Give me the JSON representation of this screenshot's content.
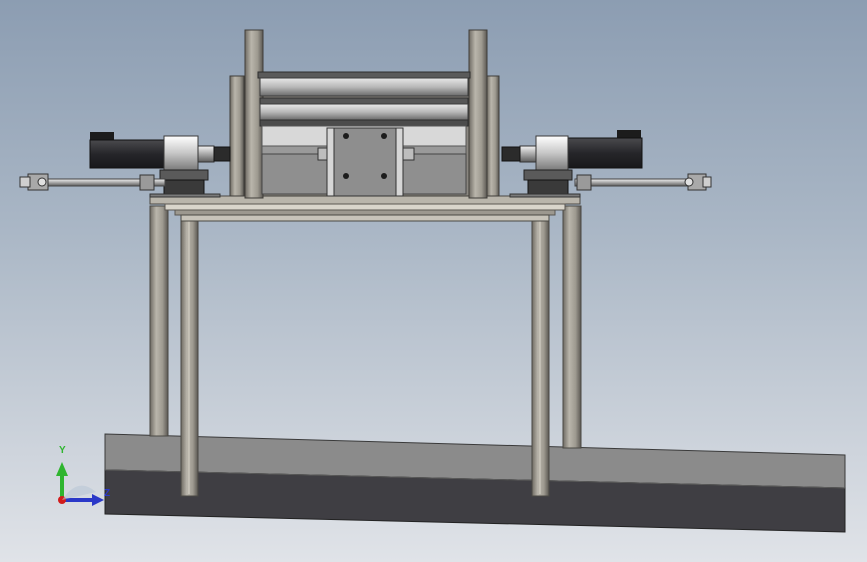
{
  "viewport": {
    "background_top": "#8c9db2",
    "background_bottom": "#e0e3e8"
  },
  "model": {
    "frame_color": "#a9a59b",
    "frame_shadow": "#5e5b55",
    "cylinder_color": "#2e2e30",
    "plate_color": "#8d8d8d",
    "floor_top": "#8a8a8a",
    "floor_side": "#3e3d42"
  },
  "triad": {
    "y_label": "Y",
    "z_label": "Z",
    "y_color": "#2fb52f",
    "z_color": "#2a38c8",
    "origin_color": "#d21c1c"
  }
}
